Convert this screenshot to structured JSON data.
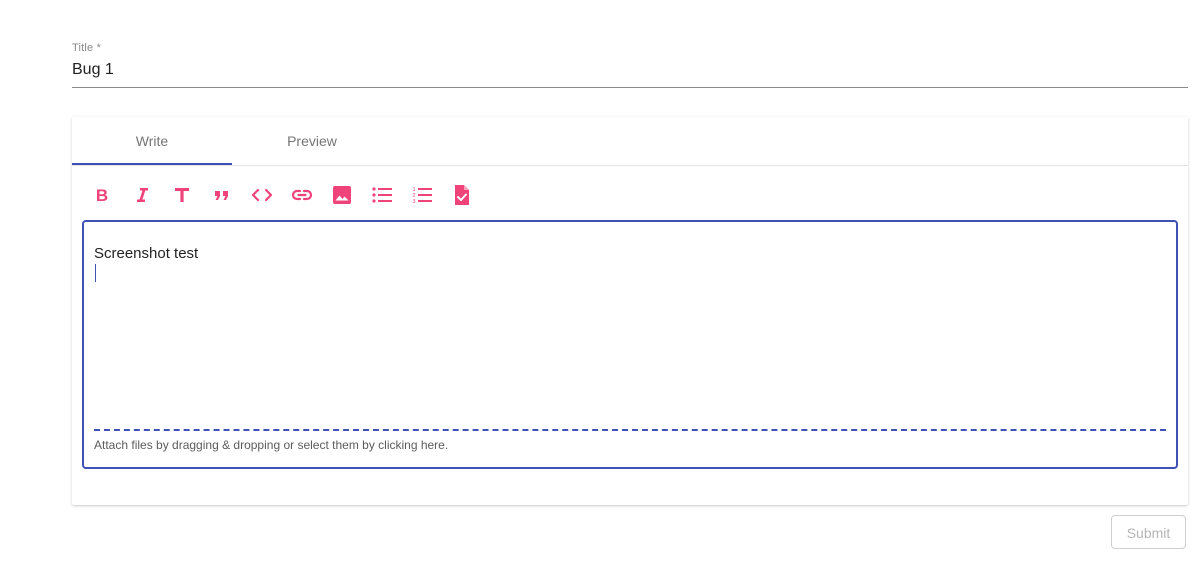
{
  "title_field": {
    "label": "Title *",
    "value": "Bug 1"
  },
  "editor": {
    "tabs": [
      {
        "label": "Write",
        "active": true
      },
      {
        "label": "Preview",
        "active": false
      }
    ],
    "toolbar": [
      {
        "name": "bold-icon",
        "icon": "bold"
      },
      {
        "name": "italic-icon",
        "icon": "italic"
      },
      {
        "name": "header-icon",
        "icon": "text-title"
      },
      {
        "name": "quote-icon",
        "icon": "quote"
      },
      {
        "name": "code-icon",
        "icon": "code"
      },
      {
        "name": "link-icon",
        "icon": "link"
      },
      {
        "name": "image-icon",
        "icon": "image"
      },
      {
        "name": "unordered-list-icon",
        "icon": "bulleted-list"
      },
      {
        "name": "ordered-list-icon",
        "icon": "numbered-list"
      },
      {
        "name": "checked-list-icon",
        "icon": "file-check"
      }
    ],
    "text": "Screenshot test",
    "attach_hint": "Attach files by dragging & dropping or select them by clicking here."
  },
  "submit_label": "Submit",
  "colors": {
    "accent": "#3f51b5",
    "toolbar_icon": "#f0437a",
    "muted_text": "#757575",
    "disabled": "#b5b5b5"
  }
}
